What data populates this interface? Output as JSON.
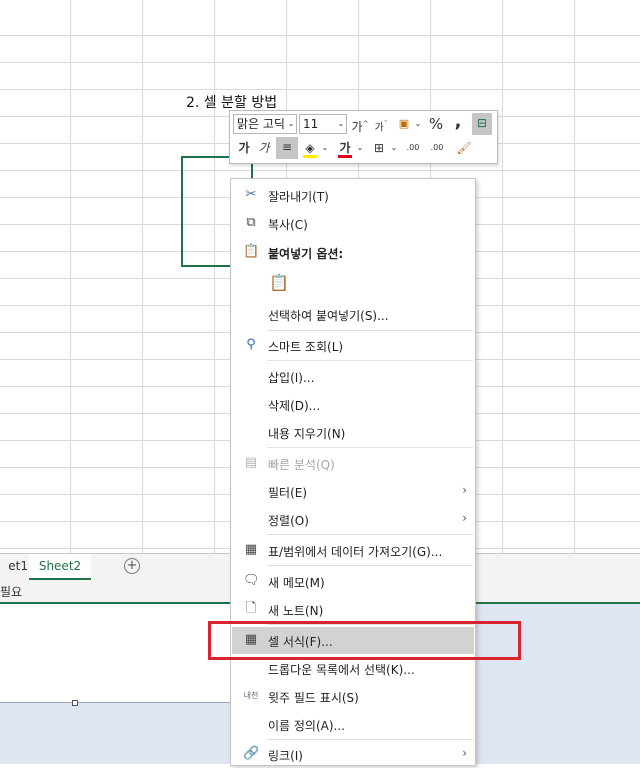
{
  "sheet": {
    "cell_text": "2. 셀 분할 방법",
    "tabs": [
      "et1",
      "Sheet2"
    ],
    "add_sheet": "⊕",
    "status": "필요"
  },
  "mini_toolbar": {
    "font_name": "맑은 고딕",
    "font_size": "11",
    "increase_font": "가",
    "decrease_font": "가",
    "percent": "%",
    "comma": ",",
    "bold": "가",
    "italic": "가",
    "font_color": "가",
    "dec_increase": ".00",
    "dec_decrease": ".00"
  },
  "context_menu": {
    "items": [
      {
        "label": "잘라내기(T)",
        "icon": "scissors-icon"
      },
      {
        "label": "복사(C)",
        "icon": "copy-icon"
      },
      {
        "label": "붙여넣기 옵션:",
        "icon": "paste-icon"
      },
      {
        "label": "선택하여 붙여넣기(S)..."
      },
      {
        "label": "스마트 조회(L)",
        "icon": "search-icon"
      },
      {
        "label": "삽입(I)..."
      },
      {
        "label": "삭제(D)..."
      },
      {
        "label": "내용 지우기(N)"
      },
      {
        "label": "빠른 분석(Q)",
        "icon": "quick-analysis-icon"
      },
      {
        "label": "필터(E)"
      },
      {
        "label": "정렬(O)"
      },
      {
        "label": "표/범위에서 데이터 가져오기(G)...",
        "icon": "table-icon"
      },
      {
        "label": "새 메모(M)",
        "icon": "new-comment-icon"
      },
      {
        "label": "새 노트(N)",
        "icon": "new-note-icon"
      },
      {
        "label": "셀 서식(F)...",
        "icon": "format-cells-icon"
      },
      {
        "label": "드롭다운 목록에서 선택(K)..."
      },
      {
        "label": "윗주 필드 표시(S)",
        "icon": "phonetic-icon",
        "icon_text": "내천"
      },
      {
        "label": "이름 정의(A)..."
      },
      {
        "label": "링크(I)",
        "icon": "link-icon"
      }
    ]
  },
  "colors": {
    "accent": "#217346",
    "highlight_box": "#d9232d",
    "hover": "#d2d2d2"
  }
}
